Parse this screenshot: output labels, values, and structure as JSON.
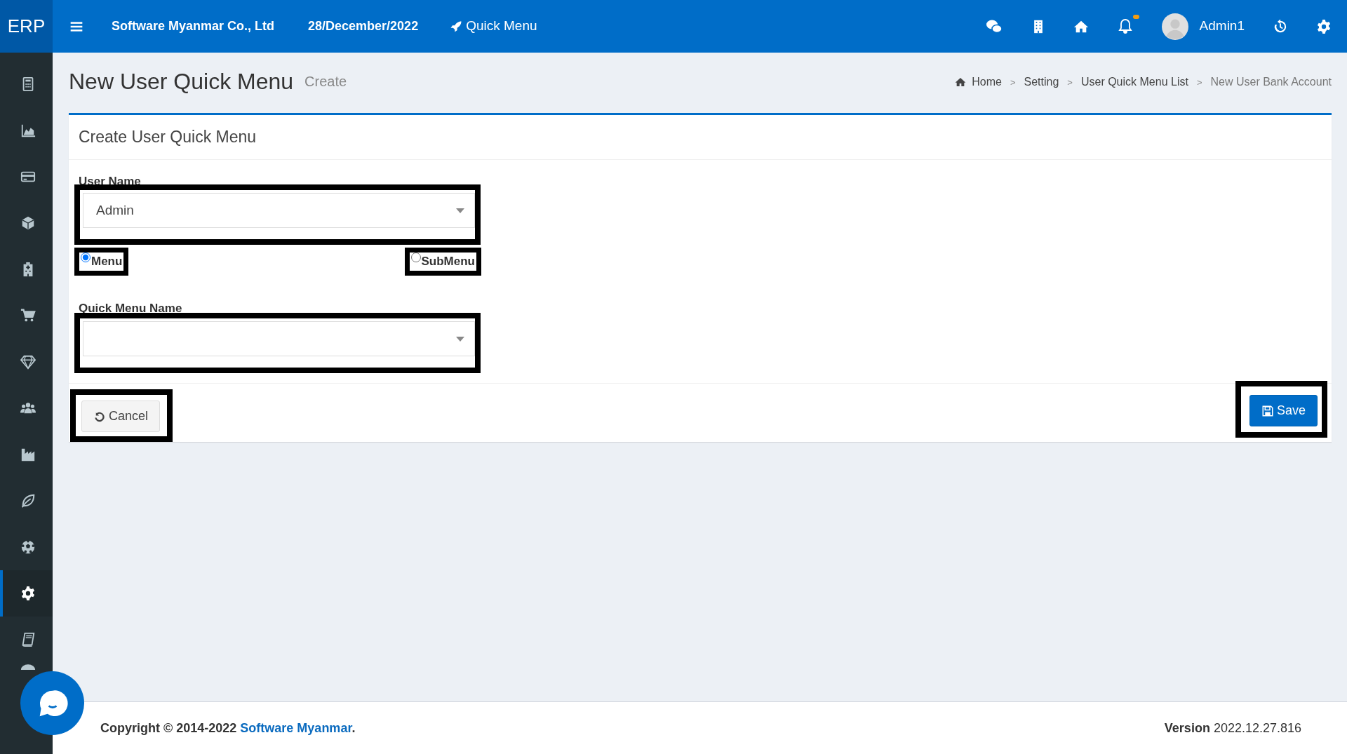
{
  "topbar": {
    "brand": "ERP",
    "company": "Software Myanmar Co., Ltd",
    "date": "28/December/2022",
    "quick_menu": "Quick Menu",
    "user": "Admin1",
    "notification_dot": true
  },
  "sidebar": {
    "items": [
      {
        "selected": false
      },
      {
        "selected": false
      },
      {
        "selected": false
      },
      {
        "selected": false
      },
      {
        "selected": false
      },
      {
        "selected": false
      },
      {
        "selected": false
      },
      {
        "selected": false
      },
      {
        "selected": false
      },
      {
        "selected": false
      },
      {
        "selected": false
      },
      {
        "selected": true
      },
      {
        "selected": false
      },
      {
        "selected": false
      }
    ]
  },
  "page": {
    "title": "New User Quick Menu",
    "subtitle": "Create"
  },
  "breadcrumb": [
    {
      "label": "Home",
      "current": false
    },
    {
      "label": "Setting",
      "current": false
    },
    {
      "label": "User Quick Menu List",
      "current": false
    },
    {
      "label": "New User Bank Account",
      "current": true
    }
  ],
  "breadcrumb_separators": [
    ">",
    ">",
    ">"
  ],
  "card": {
    "title": "Create User Quick Menu",
    "user_name": {
      "label": "User Name",
      "value": "Admin"
    },
    "menu_types": [
      {
        "label": "Menu",
        "selected": true
      },
      {
        "label": "SubMenu",
        "selected": false
      }
    ],
    "quick_menu_name": {
      "label": "Quick Menu Name"
    },
    "cancel": "Cancel",
    "save": "Save"
  },
  "footer": {
    "copyright": "Copyright © 2014-2022",
    "company_link": "Software Myanmar",
    "period": ".",
    "version_label": "Version",
    "version": "2022.12.27.816"
  }
}
